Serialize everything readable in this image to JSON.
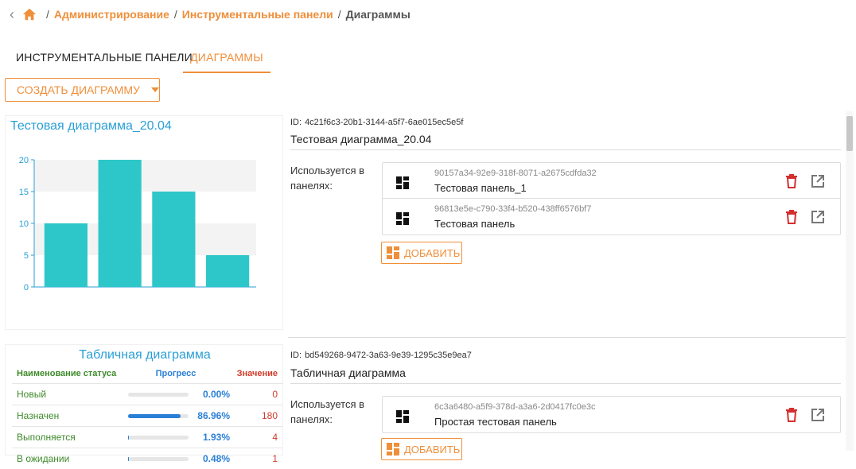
{
  "breadcrumb": {
    "separator": "/",
    "items": [
      "Администрирование",
      "Инструментальные панели"
    ],
    "current": "Диаграммы"
  },
  "tabs": [
    {
      "label": "ИНСТРУМЕНТАЛЬНЫЕ ПАНЕЛИ",
      "active": false
    },
    {
      "label": "ДИАГРАММЫ",
      "active": true
    }
  ],
  "toolbar": {
    "create_label": "СОЗДАТЬ ДИАГРАММУ"
  },
  "colors": {
    "accent": "#ef8f3a",
    "bar": "#2ec7c9",
    "title": "#2a9fd6",
    "delete": "#d32f2f"
  },
  "charts": [
    {
      "id_label": "ID:",
      "id": "4c21f6c3-20b1-3144-a5f7-6ae015ec5e5f",
      "name": "Тестовая диаграмма_20.04",
      "used_in_label": "Используется в панелях:",
      "panels": [
        {
          "id": "90157a34-92e9-318f-8071-a2675cdfda32",
          "name": "Тестовая панель_1"
        },
        {
          "id": "96813e5e-c790-33f4-b520-438ff6576bf7",
          "name": "Тестовая панель"
        }
      ],
      "add_label": "ДОБАВИТЬ"
    },
    {
      "id_label": "ID:",
      "id": "bd549268-9472-3a63-9e39-1295c35e9ea7",
      "name": "Табличная диаграмма",
      "used_in_label": "Используется в панелях:",
      "panels": [
        {
          "id": "6c3a6480-a5f9-378d-a3a6-2d0417fc0e3c",
          "name": "Простая тестовая панель"
        }
      ],
      "add_label": "ДОБАВИТЬ"
    }
  ],
  "chart_data": {
    "type": "bar",
    "title": "Тестовая диаграмма_20.04",
    "categories": [
      "",
      "",
      "",
      ""
    ],
    "values": [
      10,
      20,
      15,
      5
    ],
    "ylim": [
      0,
      20
    ],
    "yticks": [
      0,
      5,
      10,
      15,
      20
    ],
    "grid": true,
    "xlabel": "",
    "ylabel": ""
  },
  "status_table": {
    "title": "Табличная диаграмма",
    "headers": [
      "Наименование статуса",
      "Прогресс",
      "Значение"
    ],
    "rows": [
      {
        "name": "Новый",
        "progress": 0.0,
        "progress_text": "0.00%",
        "value": "0"
      },
      {
        "name": "Назначен",
        "progress": 86.96,
        "progress_text": "86.96%",
        "value": "180"
      },
      {
        "name": "Выполняется",
        "progress": 1.93,
        "progress_text": "1.93%",
        "value": "4"
      },
      {
        "name": "В ожидании",
        "progress": 0.48,
        "progress_text": "0.48%",
        "value": "1"
      }
    ]
  }
}
